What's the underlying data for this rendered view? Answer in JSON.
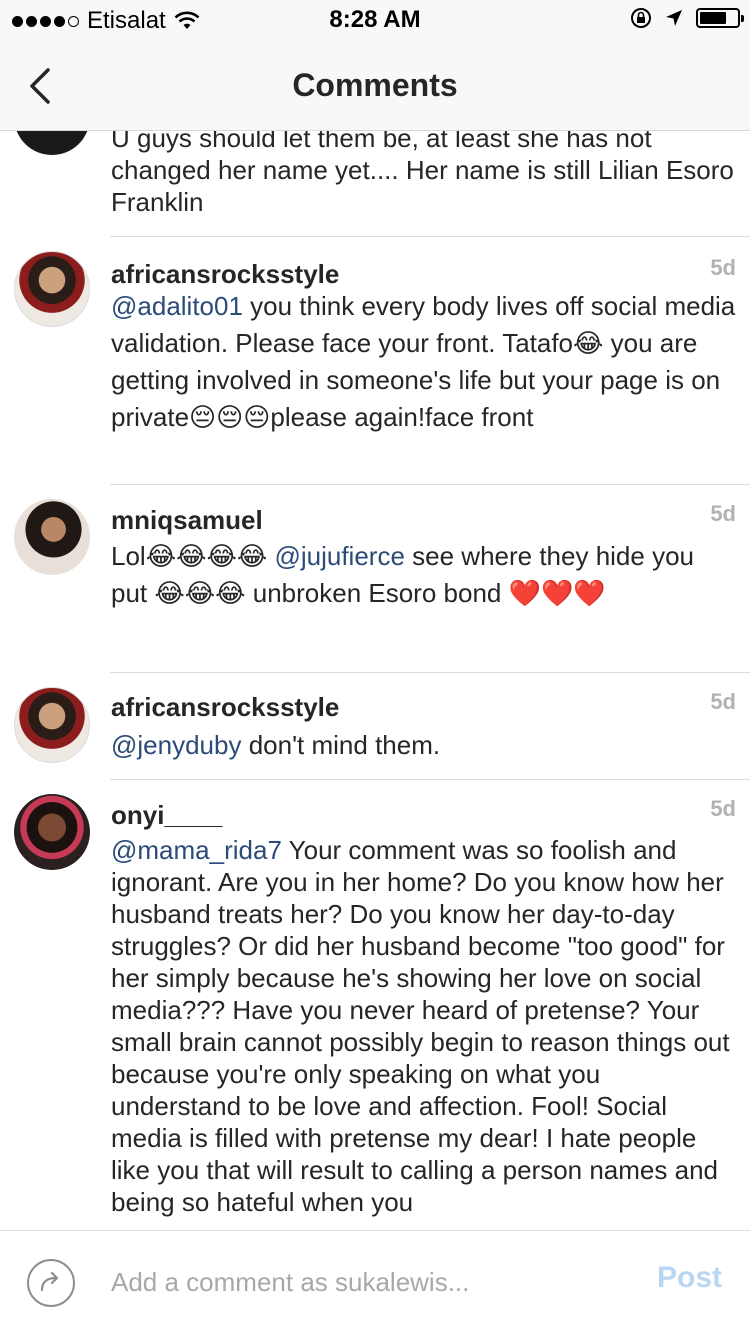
{
  "status_bar": {
    "carrier": "Etisalat",
    "time": "8:28 AM",
    "battery_level": 0.75
  },
  "nav": {
    "title": "Comments",
    "back_icon": "chevron-left-icon"
  },
  "comments": [
    {
      "username": "",
      "age": "",
      "segments": [
        {
          "type": "text",
          "value": "U guys should let them be, at least she has not changed her name yet.... Her name is still Lilian Esoro Franklin"
        }
      ]
    },
    {
      "username": "africansrocksstyle",
      "age": "5d",
      "segments": [
        {
          "type": "mention",
          "value": "@adalito01"
        },
        {
          "type": "text",
          "value": " you think every body lives off social media validation. Please face your front. Tatafo"
        },
        {
          "type": "emoji",
          "value": "😂"
        },
        {
          "type": "text",
          "value": " you are getting involved in someone's life but your page is on private"
        },
        {
          "type": "emoji",
          "value": "😔😔😔"
        },
        {
          "type": "text",
          "value": "please again!face front"
        }
      ]
    },
    {
      "username": "mniqsamuel",
      "age": "5d",
      "segments": [
        {
          "type": "text",
          "value": "Lol"
        },
        {
          "type": "emoji",
          "value": "😂😂😂😂"
        },
        {
          "type": "text",
          "value": " "
        },
        {
          "type": "mention",
          "value": "@jujufierce"
        },
        {
          "type": "text",
          "value": " see where they hide you put "
        },
        {
          "type": "emoji",
          "value": "😂😂😂"
        },
        {
          "type": "text",
          "value": " unbroken Esoro bond "
        },
        {
          "type": "emoji",
          "value": "❤️❤️❤️"
        }
      ]
    },
    {
      "username": "africansrocksstyle",
      "age": "5d",
      "segments": [
        {
          "type": "mention",
          "value": "@jenyduby"
        },
        {
          "type": "text",
          "value": " don't mind them."
        }
      ]
    },
    {
      "username": "onyi____",
      "age": "5d",
      "segments": [
        {
          "type": "mention",
          "value": "@mama_rida7"
        },
        {
          "type": "text",
          "value": " Your comment was so foolish and ignorant. Are you in her home? Do you know how her husband treats her? Do you know her day-to-day struggles? Or did her husband become \"too good\" for her simply because he's showing her love on social media??? Have you never heard of pretense? Your small brain cannot possibly begin to reason things out because you're only speaking on what you understand to be love and affection. Fool! Social media is filled with pretense my dear! I hate people like you that will result to calling a person names and being so hateful when you"
        }
      ]
    }
  ],
  "composer": {
    "placeholder": "Add a comment as sukalewis...",
    "post_label": "Post",
    "share_icon": "share-arrow-icon"
  }
}
